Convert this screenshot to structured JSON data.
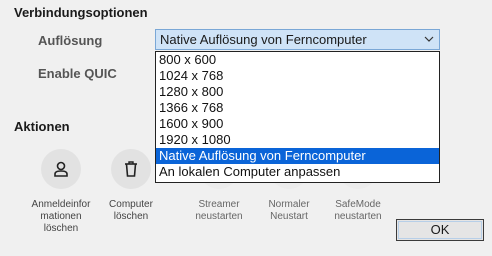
{
  "connection_options": {
    "title": "Verbindungsoptionen",
    "resolution_label": "Auflösung",
    "resolution_selected": "Native Auflösung von Ferncomputer",
    "resolution_options": [
      "800 x 600",
      "1024 x 768",
      "1280 x 800",
      "1366 x 768",
      "1600 x 900",
      "1920 x 1080",
      "Native Auflösung von Ferncomputer",
      "An lokalen Computer anpassen"
    ],
    "quic_label": "Enable QUIC"
  },
  "actions": {
    "title": "Aktionen",
    "items": [
      {
        "line1": "Anmeldeinfor",
        "line2": "mationen",
        "line3": "löschen",
        "icon": "user-icon"
      },
      {
        "line1": "Computer",
        "line2": "löschen",
        "icon": "trash-icon"
      },
      {
        "line1": "Streamer",
        "line2": "neustarten",
        "icon": "restart-icon"
      },
      {
        "line1": "Normaler",
        "line2": "Neustart",
        "icon": "reboot-icon"
      },
      {
        "line1": "SafeMode",
        "line2": "neustarten",
        "icon": "safemode-icon"
      }
    ]
  },
  "ok_label": "OK"
}
